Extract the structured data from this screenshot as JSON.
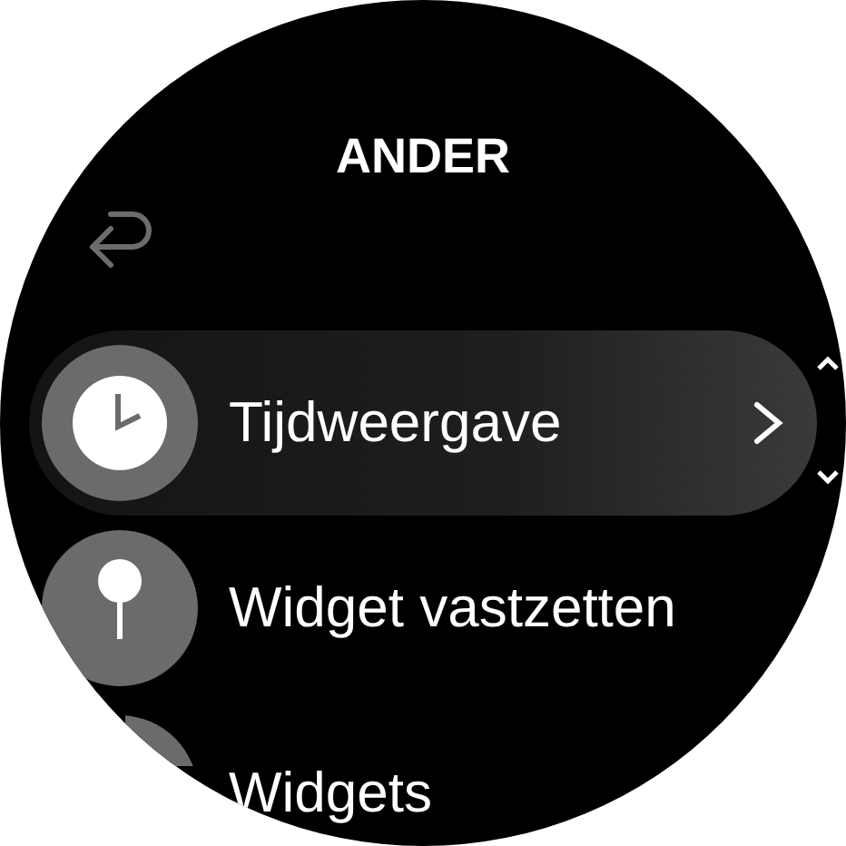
{
  "title": "ANDER",
  "menu": [
    {
      "label": "Tijdweergave",
      "kind": "clock",
      "selected": true
    },
    {
      "label": "Widget vastzetten",
      "kind": "pin",
      "selected": false
    },
    {
      "label": "Widgets",
      "kind": "blank",
      "selected": false
    }
  ]
}
